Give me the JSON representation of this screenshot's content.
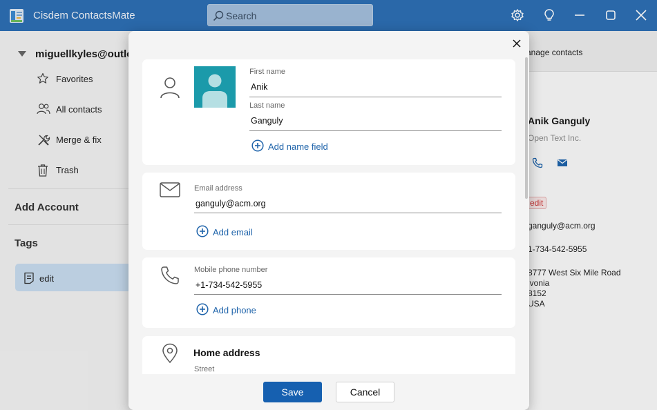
{
  "app": {
    "title": "Cisdem ContactsMate"
  },
  "search": {
    "placeholder": "Search"
  },
  "titlebar_icons": [
    "gear-icon",
    "lightbulb-icon",
    "minimize-icon",
    "maximize-icon",
    "close-icon"
  ],
  "sidebar": {
    "account": "miguellkyles@outlo",
    "items": [
      {
        "label": "Favorites",
        "icon": "star-icon"
      },
      {
        "label": "All contacts",
        "icon": "people-icon"
      },
      {
        "label": "Merge & fix",
        "icon": "tools-icon"
      },
      {
        "label": "Trash",
        "icon": "trash-icon"
      }
    ],
    "add_account": "Add Account",
    "tags_heading": "Tags",
    "tags": [
      {
        "label": "edit",
        "icon": "tag-note-icon"
      }
    ]
  },
  "right_panel": {
    "header": "anage contacts",
    "name": "Anik Ganguly",
    "company": "Open Text Inc.",
    "tag": "edit",
    "email": "ganguly@acm.org",
    "phone": "1-734-542-5955",
    "address_lines": [
      "8777 West Six Mile Road",
      "ivonia",
      "8152",
      "USA"
    ]
  },
  "dialog": {
    "name_card": {
      "first_name_label": "First name",
      "first_name_value": "Anik",
      "last_name_label": "Last name",
      "last_name_value": "Ganguly",
      "add_label": "Add name field"
    },
    "email_card": {
      "label": "Email address",
      "value": "ganguly@acm.org",
      "add_label": "Add email"
    },
    "phone_card": {
      "label": "Mobile phone number",
      "value": "+1-734-542-5955",
      "add_label": "Add phone"
    },
    "address_card": {
      "title": "Home address",
      "street_label": "Street"
    },
    "save_label": "Save",
    "cancel_label": "Cancel"
  },
  "colors": {
    "titlebar": "#2d6fb4",
    "accent": "#1660b0",
    "link": "#1e63aa",
    "avatar_bg": "#1b9aaa",
    "tag_selected_bg": "#c7dbee"
  }
}
